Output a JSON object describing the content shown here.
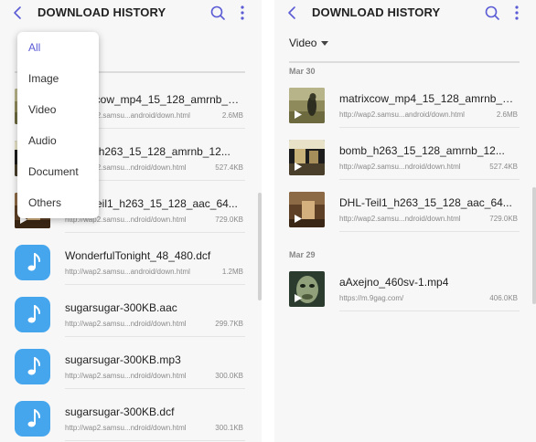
{
  "colors": {
    "accent": "#5b5bd6",
    "audio_tile": "#45a6ee"
  },
  "left": {
    "title": "DOWNLOAD HISTORY",
    "dropdown": {
      "options": [
        "All",
        "Image",
        "Video",
        "Audio",
        "Document",
        "Others"
      ],
      "selected": "All"
    },
    "items": [
      {
        "name": "matrixcow_mp4_15_128_amrnb_12...",
        "url": "http://wap2.samsu...android/down.html",
        "size": "2.6MB",
        "type": "video",
        "thumb": "cow"
      },
      {
        "name": "bomb_h263_15_128_amrnb_12...",
        "url": "http://wap2.samsu...ndroid/down.html",
        "size": "527.4KB",
        "type": "video",
        "thumb": "bomb"
      },
      {
        "name": "DHL-Teil1_h263_15_128_aac_64...",
        "url": "http://wap2.samsu...ndroid/down.html",
        "size": "729.0KB",
        "type": "video",
        "thumb": "dhl"
      },
      {
        "name": "WonderfulTonight_48_480.dcf",
        "url": "http://wap2.samsu...android/down.html",
        "size": "1.2MB",
        "type": "audio"
      },
      {
        "name": "sugarsugar-300KB.aac",
        "url": "http://wap2.samsu...ndroid/down.html",
        "size": "299.7KB",
        "type": "audio"
      },
      {
        "name": "sugarsugar-300KB.mp3",
        "url": "http://wap2.samsu...ndroid/down.html",
        "size": "300.0KB",
        "type": "audio"
      },
      {
        "name": "sugarsugar-300KB.dcf",
        "url": "http://wap2.samsu...ndroid/down.html",
        "size": "300.1KB",
        "type": "audio"
      }
    ]
  },
  "right": {
    "title": "DOWNLOAD HISTORY",
    "filter": "Video",
    "groups": [
      {
        "date": "Mar 30",
        "items": [
          {
            "name": "matrixcow_mp4_15_128_amrnb_12...",
            "url": "http://wap2.samsu...android/down.html",
            "size": "2.6MB",
            "thumb": "cow"
          },
          {
            "name": "bomb_h263_15_128_amrnb_12...",
            "url": "http://wap2.samsu...ndroid/down.html",
            "size": "527.4KB",
            "thumb": "bomb"
          },
          {
            "name": "DHL-Teil1_h263_15_128_aac_64...",
            "url": "http://wap2.samsu...ndroid/down.html",
            "size": "729.0KB",
            "thumb": "dhl"
          }
        ]
      },
      {
        "date": "Mar 29",
        "items": [
          {
            "name": "aAxejno_460sv-1.mp4",
            "url": "https://m.9gag.com/",
            "size": "406.0KB",
            "thumb": "face"
          }
        ]
      }
    ]
  }
}
